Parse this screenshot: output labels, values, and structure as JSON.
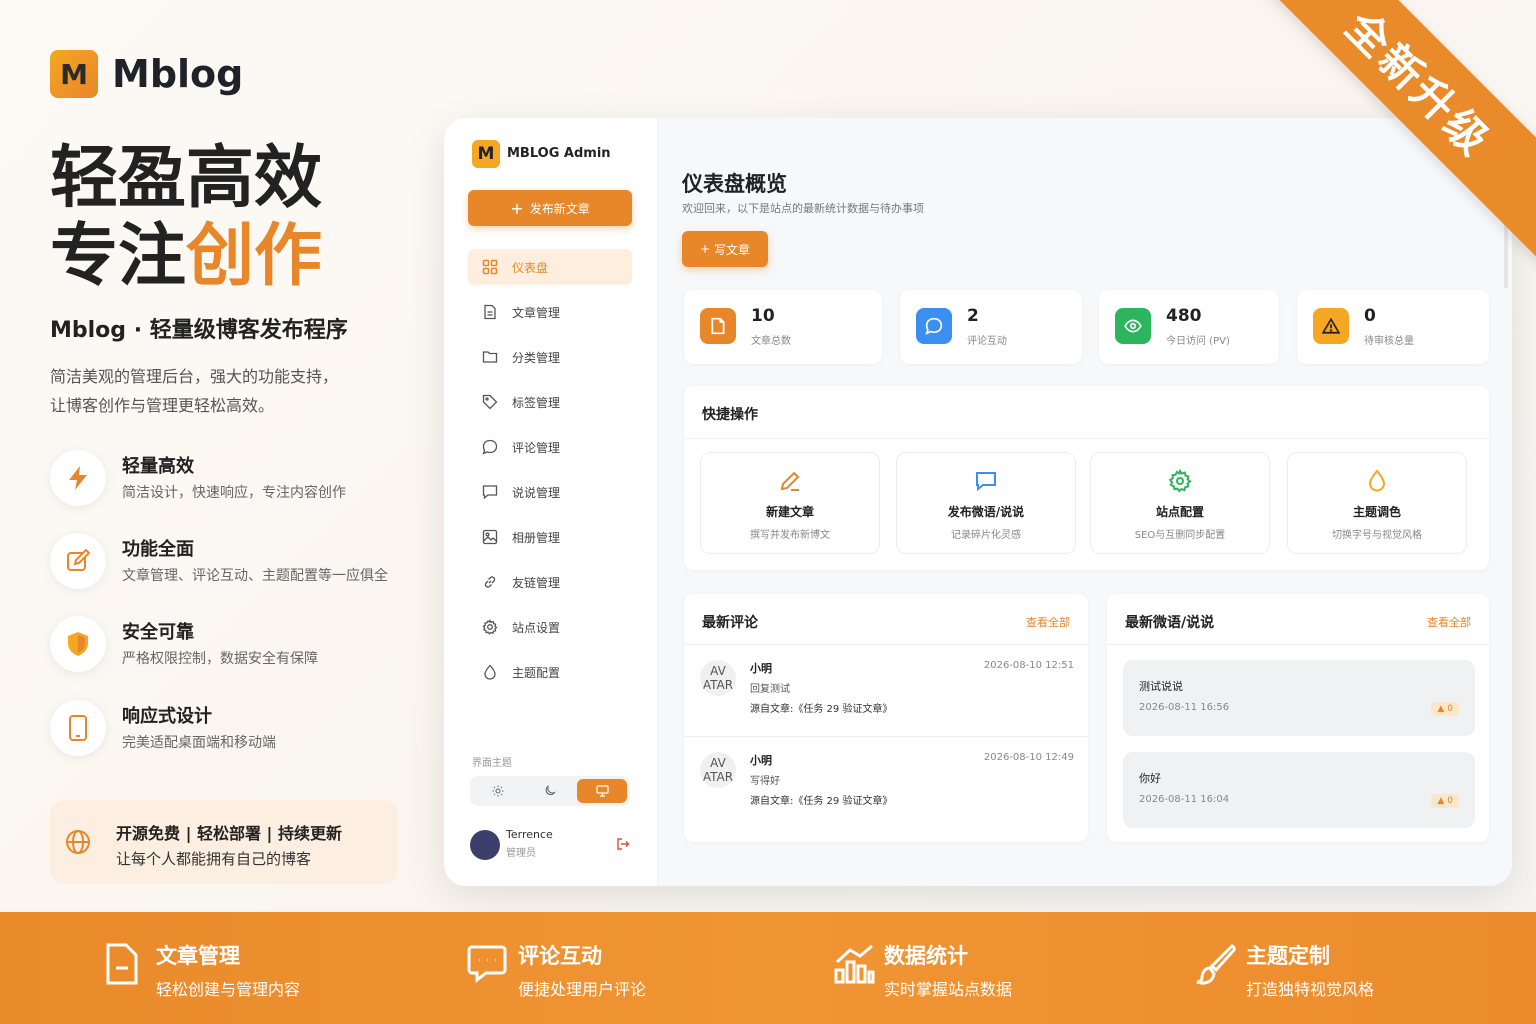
{
  "ribbon": "全新升级",
  "brand": {
    "logo_letter": "M",
    "name": "Mblog"
  },
  "hero": {
    "line1": "轻盈高效",
    "line2_plain": "专注",
    "line2_accent": "创作"
  },
  "subtitle": "Mblog · 轻量级博客发布程序",
  "description": [
    "简洁美观的管理后台，强大的功能支持，",
    "让博客创作与管理更轻松高效。"
  ],
  "features": [
    {
      "icon": "lightning-icon",
      "title": "轻量高效",
      "desc": "简洁设计，快速响应，专注内容创作"
    },
    {
      "icon": "edit-icon",
      "title": "功能全面",
      "desc": "文章管理、评论互动、主题配置等一应俱全"
    },
    {
      "icon": "shield-icon",
      "title": "安全可靠",
      "desc": "严格权限控制，数据安全有保障"
    },
    {
      "icon": "mobile-icon",
      "title": "响应式设计",
      "desc": "完美适配桌面端和移动端"
    }
  ],
  "open_source": {
    "line1": "开源免费 | 轻松部署 | 持续更新",
    "line2": "让每个人都能拥有自己的博客"
  },
  "app": {
    "logo_letter": "M",
    "title": "MBLOG Admin",
    "publish_button": "发布新文章",
    "nav": [
      {
        "icon": "dashboard-icon",
        "label": "仪表盘",
        "active": true
      },
      {
        "icon": "document-icon",
        "label": "文章管理"
      },
      {
        "icon": "folder-icon",
        "label": "分类管理"
      },
      {
        "icon": "tag-icon",
        "label": "标签管理"
      },
      {
        "icon": "comment-icon",
        "label": "评论管理"
      },
      {
        "icon": "message-icon",
        "label": "说说管理"
      },
      {
        "icon": "image-icon",
        "label": "相册管理"
      },
      {
        "icon": "link-icon",
        "label": "友链管理"
      },
      {
        "icon": "gear-icon",
        "label": "站点设置"
      },
      {
        "icon": "droplet-icon",
        "label": "主题配置"
      }
    ],
    "theme_label": "界面主题",
    "theme_options": [
      "sun-icon",
      "moon-icon",
      "monitor-icon"
    ],
    "user": {
      "name": "Terrence",
      "role": "管理员"
    },
    "main": {
      "title": "仪表盘概览",
      "subtitle": "欢迎回来，以下是站点的最新统计数据与待办事项",
      "write_button": "写文章",
      "stats": [
        {
          "icon": "document-icon",
          "value": "10",
          "label": "文章总数",
          "color": "#e8862a"
        },
        {
          "icon": "comment-icon",
          "value": "2",
          "label": "评论互动",
          "color": "#3b8ff0"
        },
        {
          "icon": "eye-icon",
          "value": "480",
          "label": "今日访问 (PV)",
          "color": "#2db55d"
        },
        {
          "icon": "warning-icon",
          "value": "0",
          "label": "待审核总量",
          "color": "#f5a623"
        }
      ],
      "quick": {
        "title": "快捷操作",
        "items": [
          {
            "icon": "pen-icon",
            "title": "新建文章",
            "desc": "撰写并发布新博文",
            "color": "#e8862a"
          },
          {
            "icon": "message-icon",
            "title": "发布微语/说说",
            "desc": "记录碎片化灵感",
            "color": "#3b8ff0"
          },
          {
            "icon": "gear-icon",
            "title": "站点配置",
            "desc": "SEO与互删同步配置",
            "color": "#2db55d"
          },
          {
            "icon": "droplet-icon",
            "title": "主题调色",
            "desc": "切换字号与视觉风格",
            "color": "#f5a623"
          }
        ]
      },
      "comments": {
        "title": "最新评论",
        "more": "查看全部",
        "items": [
          {
            "avatar": "AV ATAR",
            "name": "小明",
            "text": "回复测试",
            "source": "源自文章:《任务 29 验证文章》",
            "time": "2026-08-10 12:51"
          },
          {
            "avatar": "AV ATAR",
            "name": "小明",
            "text": "写得好",
            "source": "源自文章:《任务 29 验证文章》",
            "time": "2026-08-10 12:49"
          }
        ]
      },
      "micro": {
        "title": "最新微语/说说",
        "more": "查看全部",
        "items": [
          {
            "text": "测试说说",
            "time": "2026-08-11 16:56",
            "likes": "0"
          },
          {
            "text": "你好",
            "time": "2026-08-11 16:04",
            "likes": "0"
          }
        ]
      }
    }
  },
  "bottom": [
    {
      "icon": "file-icon",
      "title": "文章管理",
      "desc": "轻松创建与管理内容"
    },
    {
      "icon": "chat-icon",
      "title": "评论互动",
      "desc": "便捷处理用户评论"
    },
    {
      "icon": "chart-icon",
      "title": "数据统计",
      "desc": "实时掌握站点数据"
    },
    {
      "icon": "brush-icon",
      "title": "主题定制",
      "desc": "打造独特视觉风格"
    }
  ]
}
